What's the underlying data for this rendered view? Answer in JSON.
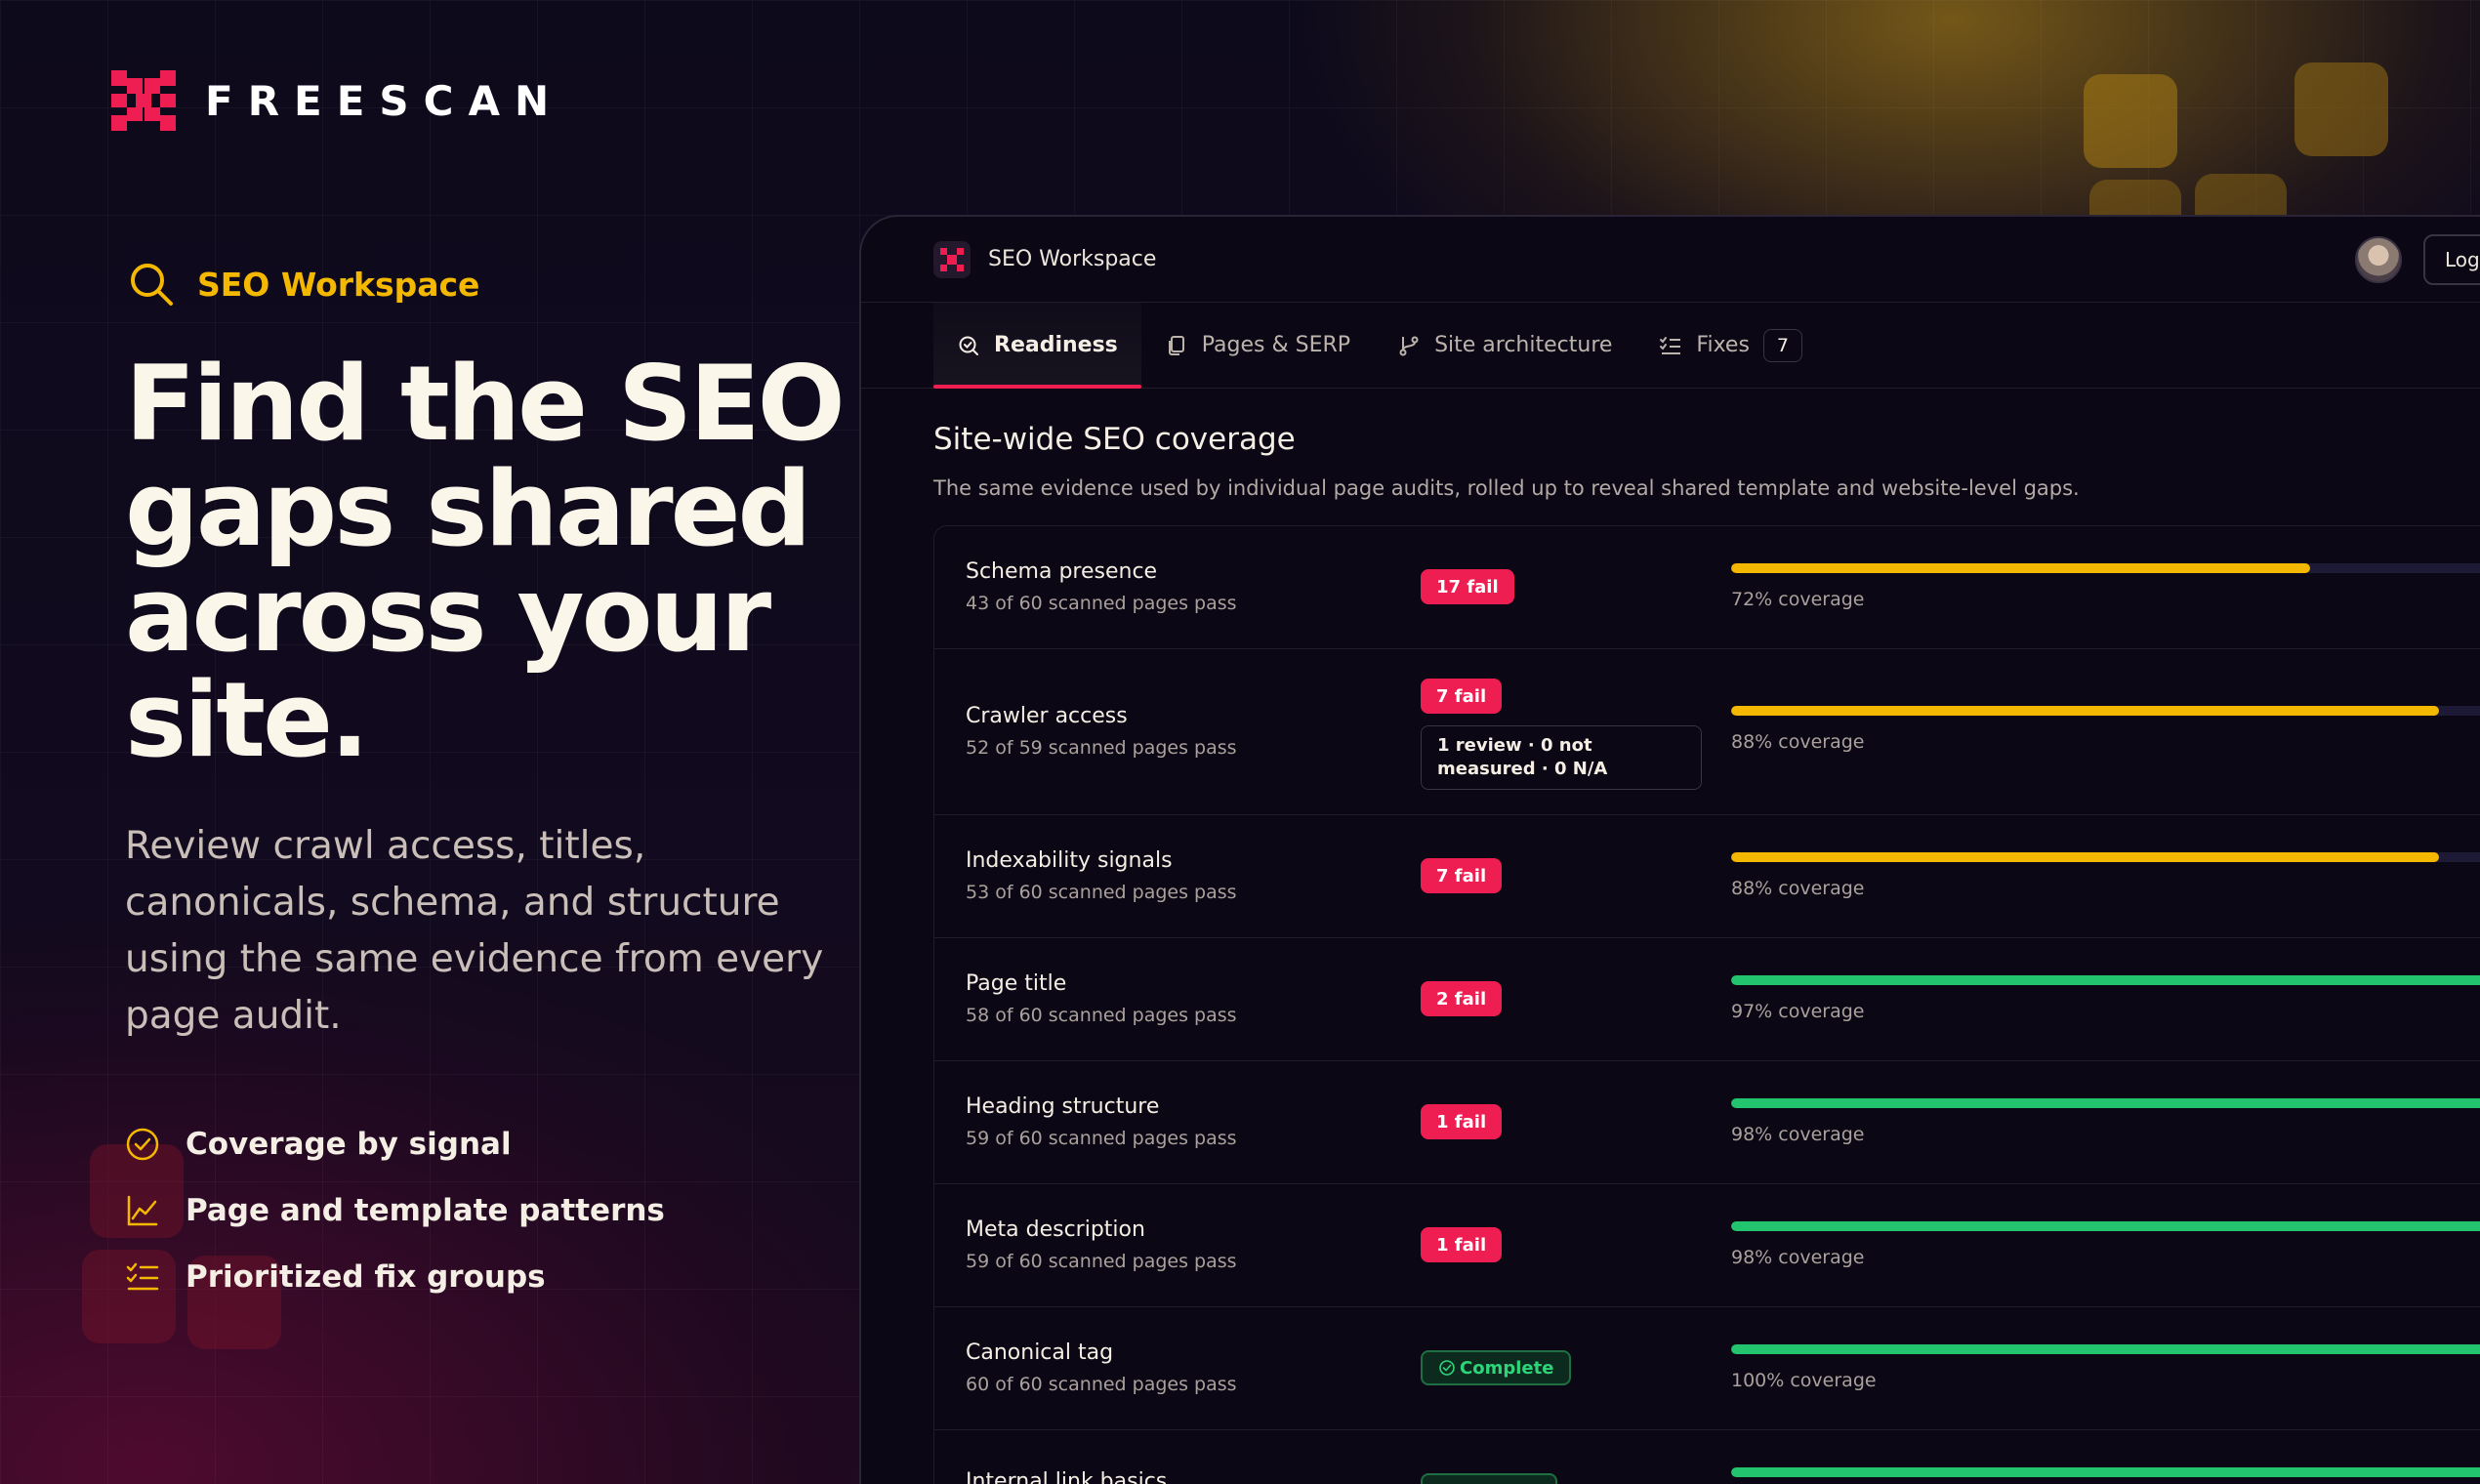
{
  "brand": {
    "name": "FREESCAN",
    "accent": "#ee1d52",
    "yellow": "#f5b800",
    "green": "#22c46e"
  },
  "hero": {
    "tag": "SEO Workspace",
    "title": "Find the SEO gaps shared across your site.",
    "subtitle": "Review crawl access, titles, canonicals, schema, and structure using the same evidence from every page audit.",
    "features": [
      {
        "icon": "check-circle-icon",
        "label": "Coverage by signal"
      },
      {
        "icon": "trend-chart-icon",
        "label": "Page and template patterns"
      },
      {
        "icon": "checklist-icon",
        "label": "Prioritized fix groups"
      }
    ]
  },
  "app": {
    "title": "SEO Workspace",
    "login_label": "Log",
    "tabs": [
      {
        "label": "Readiness",
        "icon": "readiness-icon",
        "active": true
      },
      {
        "label": "Pages & SERP",
        "icon": "pages-icon"
      },
      {
        "label": "Site architecture",
        "icon": "branch-icon"
      },
      {
        "label": "Fixes",
        "icon": "checklist-icon",
        "count": "7"
      }
    ],
    "section": {
      "title": "Site-wide SEO coverage",
      "subtitle": "The same evidence used by individual page audits, rolled up to reveal shared template and website-level gaps."
    },
    "rows": [
      {
        "name": "Schema presence",
        "meta": "43 of 60 scanned pages pass",
        "badge": "17 fail",
        "status": "fail",
        "coverage": 72,
        "coverage_label": "72% coverage",
        "color": "#f5b800"
      },
      {
        "name": "Crawler access",
        "meta": "52 of 59 scanned pages pass",
        "badge": "7 fail",
        "status": "fail",
        "note": "1 review · 0 not measured · 0 N/A",
        "coverage": 88,
        "coverage_label": "88% coverage",
        "color": "#f5b800"
      },
      {
        "name": "Indexability signals",
        "meta": "53 of 60 scanned pages pass",
        "badge": "7 fail",
        "status": "fail",
        "coverage": 88,
        "coverage_label": "88% coverage",
        "color": "#f5b800"
      },
      {
        "name": "Page title",
        "meta": "58 of 60 scanned pages pass",
        "badge": "2 fail",
        "status": "fail",
        "coverage": 97,
        "coverage_label": "97% coverage",
        "color": "#22c46e"
      },
      {
        "name": "Heading structure",
        "meta": "59 of 60 scanned pages pass",
        "badge": "1 fail",
        "status": "fail",
        "coverage": 98,
        "coverage_label": "98% coverage",
        "color": "#22c46e"
      },
      {
        "name": "Meta description",
        "meta": "59 of 60 scanned pages pass",
        "badge": "1 fail",
        "status": "fail",
        "coverage": 98,
        "coverage_label": "98% coverage",
        "color": "#22c46e"
      },
      {
        "name": "Canonical tag",
        "meta": "60 of 60 scanned pages pass",
        "badge": "Complete",
        "status": "complete",
        "coverage": 100,
        "coverage_label": "100% coverage",
        "color": "#22c46e"
      },
      {
        "name": "Internal link basics",
        "meta": "",
        "badge": "",
        "status": "complete",
        "coverage": 100,
        "coverage_label": "",
        "color": "#22c46e"
      }
    ]
  }
}
